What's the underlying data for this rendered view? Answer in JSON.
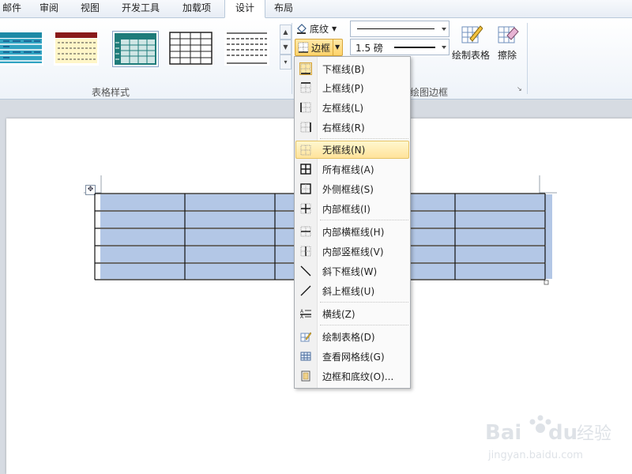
{
  "tabs": [
    {
      "label": "邮件",
      "active": false
    },
    {
      "label": "审阅",
      "active": false
    },
    {
      "label": "视图",
      "active": false
    },
    {
      "label": "开发工具",
      "active": false
    },
    {
      "label": "加载项",
      "active": false
    },
    {
      "label": "设计",
      "active": true
    },
    {
      "label": "布局",
      "active": false
    }
  ],
  "ribbon": {
    "table_styles_label": "表格样式",
    "shading_label": "底纹",
    "borders_label": "边框",
    "pen_weight": "1.5 磅",
    "draw_table_label": "绘制表格",
    "eraser_label": "擦除",
    "draw_borders_label": "绘图边框"
  },
  "border_menu": {
    "items": [
      {
        "label": "下框线(B)",
        "icon": "bottom-border-icon"
      },
      {
        "label": "上框线(P)",
        "icon": "top-border-icon"
      },
      {
        "label": "左框线(L)",
        "icon": "left-border-icon"
      },
      {
        "label": "右框线(R)",
        "icon": "right-border-icon"
      },
      {
        "label": "无框线(N)",
        "icon": "no-border-icon",
        "highlighted": true
      },
      {
        "label": "所有框线(A)",
        "icon": "all-borders-icon"
      },
      {
        "label": "外侧框线(S)",
        "icon": "outside-borders-icon"
      },
      {
        "label": "内部框线(I)",
        "icon": "inside-borders-icon"
      },
      {
        "label": "内部横框线(H)",
        "icon": "inside-horizontal-border-icon"
      },
      {
        "label": "内部竖框线(V)",
        "icon": "inside-vertical-border-icon"
      },
      {
        "label": "斜下框线(W)",
        "icon": "diagonal-down-border-icon"
      },
      {
        "label": "斜上框线(U)",
        "icon": "diagonal-up-border-icon"
      },
      {
        "label": "横线(Z)",
        "icon": "horizontal-line-icon"
      },
      {
        "label": "绘制表格(D)",
        "icon": "draw-table-icon"
      },
      {
        "label": "查看网格线(G)",
        "icon": "view-gridlines-icon"
      },
      {
        "label": "边框和底纹(O)...",
        "icon": "borders-shading-icon"
      }
    ]
  },
  "colors": {
    "selection_fill": "#b3c7e6",
    "highlight": "#ffe39a",
    "accent": "#e8a93a"
  }
}
